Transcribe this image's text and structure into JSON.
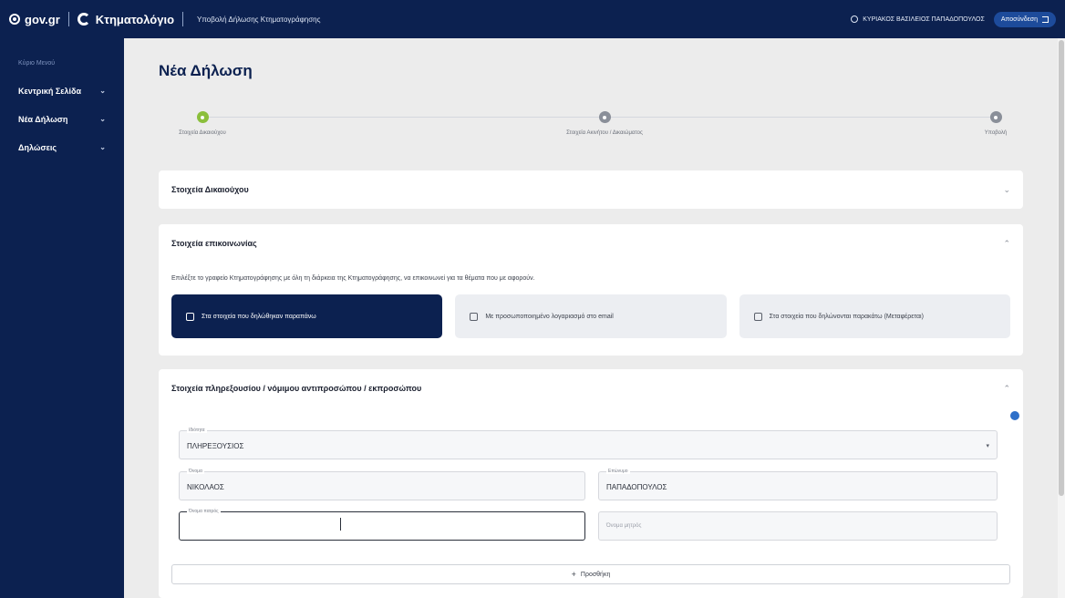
{
  "topbar": {
    "gov_logo": "gov.gr",
    "app_name": "Κτηματολόγιο",
    "app_subtitle": "Υποβολή Δήλωσης Κτηματογράφησης",
    "user_name": "ΚΥΡΙΑΚΟΣ ΒΑΣΙΛΕΙΟΣ ΠΑΠΑΔΟΠΟΥΛΟΣ",
    "logout_label": "Αποσύνδεση"
  },
  "sidebar": {
    "label": "Κύριο Μενού",
    "items": [
      {
        "label": "Κεντρική Σελίδα"
      },
      {
        "label": "Νέα Δήλωση"
      },
      {
        "label": "Δηλώσεις"
      }
    ]
  },
  "page": {
    "title": "Νέα Δήλωση"
  },
  "stepper": {
    "steps": [
      {
        "label": "Στοιχεία Δικαιούχου",
        "active": true
      },
      {
        "label": "Στοιχεία Ακινήτου / Δικαιώματος",
        "active": false
      },
      {
        "label": "Υποβολή",
        "active": false
      }
    ]
  },
  "sections": {
    "beneficiary": {
      "title": "Στοιχεία Δικαιούχου"
    },
    "contact": {
      "title": "Στοιχεία επικοινωνίας",
      "text": "Επιλέξτε το γραφείο Κτηματογράφησης με όλη τη διάρκεια της Κτηματογράφησης, να επικοινωνεί για τα θέματα που με αφορούν.",
      "options": [
        {
          "label": "Στα στοιχεία που δηλώθηκαν παραπάνω",
          "selected": true
        },
        {
          "label": "Με προσωποποιημένο λογαριασμό στο email",
          "selected": false
        },
        {
          "label": "Στα στοιχεία που δηλώνονται παρακάτω (Μεταφέρεται)",
          "selected": false
        }
      ]
    },
    "representative": {
      "title": "Στοιχεία πληρεξουσίου / νόμιμου αντιπροσώπου / εκπροσώπου",
      "fields": {
        "type": {
          "label": "Ιδιότητα",
          "value": "ΠΛΗΡΕΞΟΥΣΙΟΣ"
        },
        "first_name": {
          "label": "Όνομα",
          "value": "ΝΙΚΟΛΑΟΣ"
        },
        "last_name": {
          "label": "Επώνυμο",
          "value": "ΠΑΠΑΔΟΠΟΥΛΟΣ"
        },
        "father_name": {
          "label": "Όνομα πατρός",
          "value": ""
        },
        "mother_name": {
          "placeholder": "Όνομα μητρός"
        }
      },
      "add_label": "Προσθήκη"
    }
  }
}
